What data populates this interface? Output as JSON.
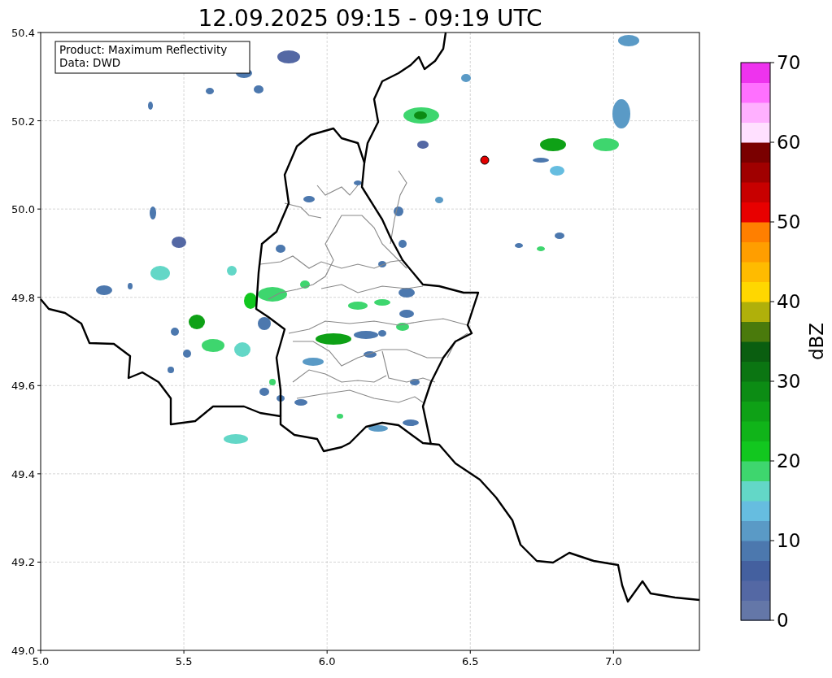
{
  "title": "12.09.2025 09:15 - 09:19 UTC",
  "legend": {
    "lines": [
      "Product: Maximum Reflectivity",
      "Data: DWD"
    ]
  },
  "map": {
    "x_ticks": [
      "5.0",
      "5.5",
      "6.0",
      "6.5",
      "7.0"
    ],
    "y_ticks": [
      "50.4",
      "50.2",
      "50.0",
      "49.8",
      "49.6",
      "49.4",
      "49.2",
      "49.0"
    ]
  },
  "colorbar": {
    "label": "dBZ",
    "ticks": [
      "70",
      "60",
      "50",
      "40",
      "30",
      "20",
      "10",
      "0"
    ],
    "segments": [
      {
        "color": "#6477a8"
      },
      {
        "color": "#5468a4"
      },
      {
        "color": "#44609f"
      },
      {
        "color": "#4c78ae"
      },
      {
        "color": "#5a9ac6"
      },
      {
        "color": "#66bde0"
      },
      {
        "color": "#63d7c7"
      },
      {
        "color": "#3ed66e"
      },
      {
        "color": "#12c71f"
      },
      {
        "color": "#10b419"
      },
      {
        "color": "#0ea116"
      },
      {
        "color": "#0c8c14"
      },
      {
        "color": "#0b7512"
      },
      {
        "color": "#0a5e10"
      },
      {
        "color": "#4a7a0c"
      },
      {
        "color": "#b0b00a"
      },
      {
        "color": "#ffd700"
      },
      {
        "color": "#ffbb00"
      },
      {
        "color": "#ff9e00"
      },
      {
        "color": "#ff7f00"
      },
      {
        "color": "#e80000"
      },
      {
        "color": "#c80000"
      },
      {
        "color": "#a00000"
      },
      {
        "color": "#7a0000"
      },
      {
        "color": "#ffe0ff"
      },
      {
        "color": "#ffb0ff"
      },
      {
        "color": "#ff70ff"
      },
      {
        "color": "#ee33ee"
      }
    ]
  }
}
